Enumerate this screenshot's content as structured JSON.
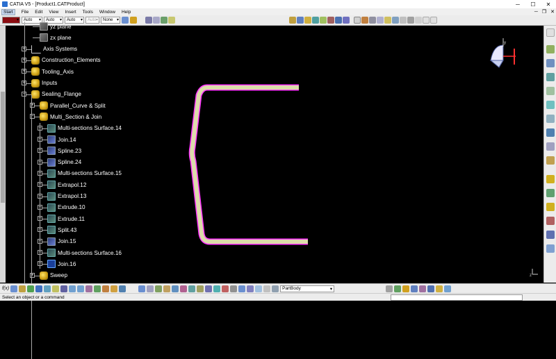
{
  "window": {
    "title": "CATIA V5 - [Product1.CATProduct]",
    "minimize": "─",
    "maximize": "☐",
    "close": "✕"
  },
  "menu": [
    "Start",
    "File",
    "Edit",
    "View",
    "Insert",
    "Tools",
    "Window",
    "Help"
  ],
  "toolbar": {
    "color_value": "",
    "combos": [
      "Auto",
      "Auto",
      "Auto",
      "Auto"
    ],
    "line_style": "None"
  },
  "tree": [
    {
      "label": "yz plane",
      "icon": "plane-icon",
      "level": 3
    },
    {
      "label": "zx plane",
      "icon": "plane-icon",
      "level": 3
    },
    {
      "label": "Axis Systems",
      "icon": "axis-system-icon",
      "level": 2
    },
    {
      "label": "Construction_Elements",
      "icon": "geometrical-set-icon",
      "level": 2
    },
    {
      "label": "Tooling_Axis",
      "icon": "geometrical-set-icon",
      "level": 2
    },
    {
      "label": "Inputs",
      "icon": "geometrical-set-icon",
      "level": 2
    },
    {
      "label": "Sealing_Flange",
      "icon": "geometrical-set-icon",
      "level": 2
    },
    {
      "label": "Parallel_Curve & Split",
      "icon": "geometrical-set-icon",
      "level": 3
    },
    {
      "label": "Multi_Section & Join",
      "icon": "geometrical-set-icon",
      "level": 3
    },
    {
      "label": "Multi-sections Surface.14",
      "icon": "multi-section-surface-icon",
      "level": 4
    },
    {
      "label": "Join.14",
      "icon": "join-icon",
      "level": 4
    },
    {
      "label": "Spline.23",
      "icon": "spline-icon",
      "level": 4
    },
    {
      "label": "Spline.24",
      "icon": "spline-icon",
      "level": 4
    },
    {
      "label": "Multi-sections Surface.15",
      "icon": "multi-section-surface-icon",
      "level": 4
    },
    {
      "label": "Extrapol.12",
      "icon": "extrapol-icon",
      "level": 4
    },
    {
      "label": "Extrapol.13",
      "icon": "extrapol-icon",
      "level": 4
    },
    {
      "label": "Extrude.10",
      "icon": "extrude-icon",
      "level": 4
    },
    {
      "label": "Extrude.11",
      "icon": "extrude-icon",
      "level": 4
    },
    {
      "label": "Split.43",
      "icon": "split-icon",
      "level": 4
    },
    {
      "label": "Join.15",
      "icon": "join-icon",
      "level": 4
    },
    {
      "label": "Multi-sections Surface.16",
      "icon": "multi-section-surface-icon",
      "level": 4
    },
    {
      "label": "Join.16",
      "icon": "join-icon",
      "level": 4
    },
    {
      "label": "Sweep",
      "icon": "geometrical-set-icon",
      "level": 3
    }
  ],
  "bottom": {
    "partbody": "PartBody"
  },
  "status": {
    "message": "Select an object or a command"
  },
  "compass": {
    "axis_label": "y"
  },
  "corner_axes": {
    "label": "z"
  },
  "colors": {
    "background": "#000000",
    "surface_fill": "#dcdcaa",
    "surface_edge": "#ff33ff",
    "tree_text": "#ffffff"
  }
}
